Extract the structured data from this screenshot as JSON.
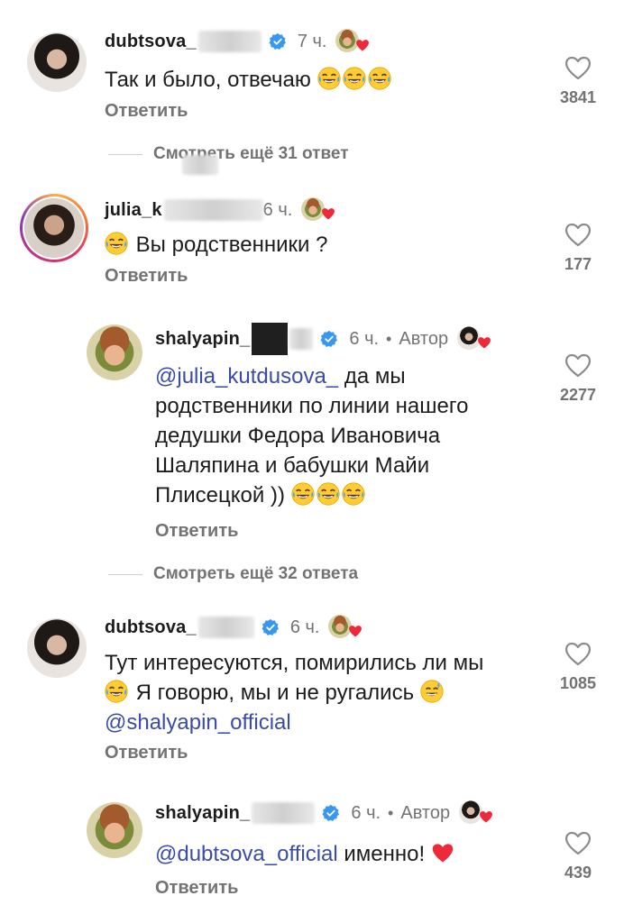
{
  "icons": {
    "heart": "heart-outline-icon",
    "verified": "verified-badge-icon",
    "laugh": "laughing-emoji-icon",
    "sweat": "sweat-smile-emoji-icon",
    "red_heart": "red-heart-emoji-icon"
  },
  "colors": {
    "mention": "#3b4ba8",
    "meta": "#737373",
    "verified": "#3897f0",
    "heart": "#ed4956"
  },
  "comments": [
    {
      "username": "dubtsova_",
      "time": "7 ч.",
      "text": "Так и было, отвечаю",
      "reply_label": "Ответить",
      "likes": "3841"
    },
    {
      "more_replies": "Смотреть ещё 31 ответ"
    },
    {
      "username": "julia_k",
      "time": "6 ч.",
      "text": "Вы родственники ?",
      "reply_label": "Ответить",
      "likes": "177"
    },
    {
      "username": "shalyapin_",
      "time": "6 ч.",
      "author_label": "Автор",
      "mention": "@julia_kutdusova_",
      "text_lines": [
        "да мы",
        "родственники по линии нашего",
        "дедушки Федора Ивановича",
        "Шаляпина и бабушки Майи",
        "Плисецкой ))"
      ],
      "reply_label": "Ответить",
      "likes": "2277"
    },
    {
      "more_replies": "Смотреть ещё 32 ответа"
    },
    {
      "username": "dubtsova_",
      "time": "6 ч.",
      "text_line1": "Тут интересуются, помирились ли мы",
      "text_line2": "Я говорю, мы и не ругались",
      "mention": "@shalyapin_official",
      "reply_label": "Ответить",
      "likes": "1085"
    },
    {
      "username": "shalyapin_",
      "time": "6 ч.",
      "author_label": "Автор",
      "mention": "@dubtsova_official",
      "text": "именно!",
      "reply_label": "Ответить",
      "likes": "439"
    }
  ]
}
